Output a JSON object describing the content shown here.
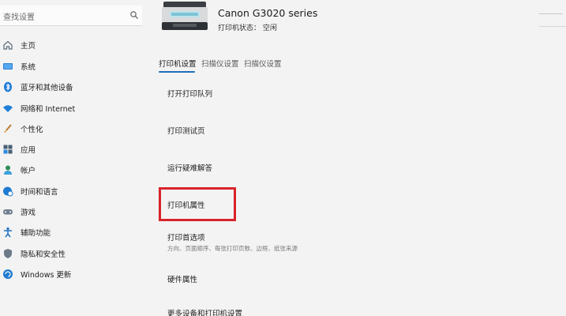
{
  "search": {
    "placeholder": "查找设置"
  },
  "sidebar": {
    "items": [
      {
        "label": "主页",
        "icon": "home-icon"
      },
      {
        "label": "系统",
        "icon": "monitor-icon"
      },
      {
        "label": "蓝牙和其他设备",
        "icon": "bluetooth-icon"
      },
      {
        "label": "网络和 Internet",
        "icon": "wifi-icon"
      },
      {
        "label": "个性化",
        "icon": "brush-icon"
      },
      {
        "label": "应用",
        "icon": "apps-icon"
      },
      {
        "label": "帐户",
        "icon": "person-icon"
      },
      {
        "label": "时间和语言",
        "icon": "globe-clock-icon"
      },
      {
        "label": "游戏",
        "icon": "gamepad-icon"
      },
      {
        "label": "辅助功能",
        "icon": "accessibility-icon"
      },
      {
        "label": "隐私和安全性",
        "icon": "shield-icon"
      },
      {
        "label": "Windows 更新",
        "icon": "update-icon"
      }
    ]
  },
  "printer": {
    "name": "Canon G3020 series",
    "status": "打印机状态：  空闲"
  },
  "tabs": [
    {
      "label": "打印机设置",
      "active": true
    },
    {
      "label": "扫描仪设置",
      "active": false
    },
    {
      "label": "扫描仪设置",
      "active": false
    }
  ],
  "settings": [
    {
      "label": "打开打印队列"
    },
    {
      "label": "打印测试页"
    },
    {
      "label": "运行疑难解答"
    },
    {
      "label": "打印机属性"
    },
    {
      "label": "打印首选项",
      "description": "方向、页面顺序、每张打印页数、边框、纸张来源"
    },
    {
      "label": "硬件属性"
    },
    {
      "label": "更多设备和打印机设置"
    }
  ],
  "colors": {
    "accent": "#1f6fb8",
    "highlight": "#d8232a",
    "background": "#f3f3f3"
  }
}
